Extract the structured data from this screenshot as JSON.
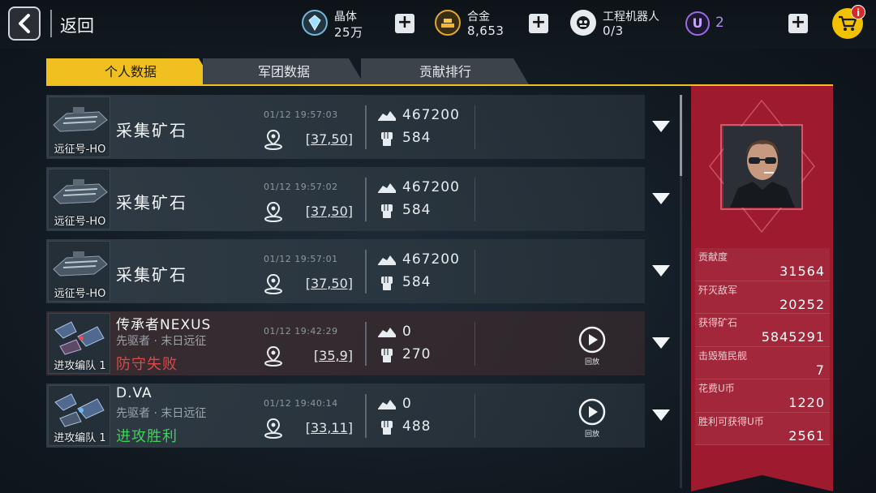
{
  "header": {
    "back_label": "返回",
    "resources": [
      {
        "name": "晶体",
        "value": "25万",
        "icon": "crystal-icon"
      },
      {
        "name": "合金",
        "value": "8,653",
        "icon": "alloy-icon"
      },
      {
        "name": "工程机器人",
        "value": "0/3",
        "icon": "robot-icon"
      }
    ],
    "u_icon": "U",
    "u_value": "2",
    "cart_badge": "i"
  },
  "tabs": [
    {
      "label": "个人数据",
      "active": true
    },
    {
      "label": "军团数据",
      "active": false
    },
    {
      "label": "贡献排行",
      "active": false
    }
  ],
  "records": [
    {
      "type": "gather",
      "thumb_label": "远征号-HO",
      "title": "采集矿石",
      "timestamp": "01/12 19:57:03",
      "coord": "[37,50]",
      "ore": "467200",
      "power": "584"
    },
    {
      "type": "gather",
      "thumb_label": "远征号-HO",
      "title": "采集矿石",
      "timestamp": "01/12 19:57:02",
      "coord": "[37,50]",
      "ore": "467200",
      "power": "584"
    },
    {
      "type": "gather",
      "thumb_label": "远征号-HO",
      "title": "采集矿石",
      "timestamp": "01/12 19:57:01",
      "coord": "[37,50]",
      "ore": "467200",
      "power": "584"
    },
    {
      "type": "battle",
      "thumb_label": "进攻编队 1",
      "name": "传承者NEXUS",
      "sub": "先驱者 · 末日远征",
      "result": "防守失败",
      "result_color": "#e04848",
      "timestamp": "01/12 19:42:29",
      "coord": "[35,9]",
      "ore": "0",
      "power": "270",
      "replay_label": "回放"
    },
    {
      "type": "battle",
      "thumb_label": "进攻编队 1",
      "name": "D.VA",
      "sub": "先驱者 · 末日远征",
      "result": "进攻胜利",
      "result_color": "#3fd15a",
      "timestamp": "01/12 19:40:14",
      "coord": "[33,11]",
      "ore": "0",
      "power": "488",
      "replay_label": "回放"
    }
  ],
  "panel": {
    "stats": [
      {
        "label": "贡献度",
        "value": "31564"
      },
      {
        "label": "歼灭敌军",
        "value": "20252"
      },
      {
        "label": "获得矿石",
        "value": "5845291"
      },
      {
        "label": "击毁殖民舰",
        "value": "7"
      },
      {
        "label": "花费U币",
        "value": "1220"
      },
      {
        "label": "胜利可获得U币",
        "value": "2561"
      }
    ]
  },
  "colors": {
    "accent": "#f0c020",
    "panel": "#9e1a2e",
    "defeat": "#e04848",
    "victory": "#3fd15a",
    "u_currency": "#b48af0"
  }
}
